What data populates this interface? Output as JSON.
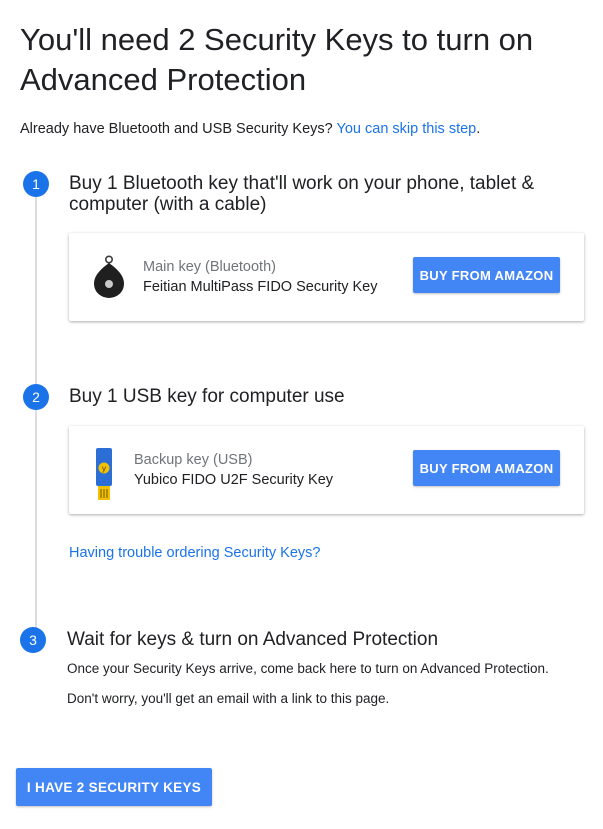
{
  "page": {
    "title": "You'll need 2 Security Keys to turn on Advanced Protection",
    "intro_text": "Already have Bluetooth and USB Security Keys? ",
    "intro_link": "You can skip this step",
    "intro_end": "."
  },
  "steps": [
    {
      "number": "1",
      "title": "Buy 1 Bluetooth key that'll work on your phone, tablet & computer (with a cable)",
      "card": {
        "icon": "bluetooth-key-icon",
        "key_type": "Main key (Bluetooth)",
        "key_name": "Feitian MultiPass FIDO Security Key",
        "button_label": "BUY FROM AMAZON"
      }
    },
    {
      "number": "2",
      "title": "Buy 1 USB key for computer use",
      "card": {
        "icon": "usb-key-icon",
        "key_type": "Backup key (USB)",
        "key_name": "Yubico FIDO U2F Security Key",
        "button_label": "BUY FROM AMAZON"
      },
      "help_link": "Having trouble ordering Security Keys?"
    },
    {
      "number": "3",
      "title": "Wait for keys & turn on Advanced Protection",
      "lines": [
        "Once your Security Keys arrive, come back here to turn on Advanced Protection.",
        "Don't worry, you'll get an email with a link to this page."
      ]
    }
  ],
  "primary_button": "I HAVE 2 SECURITY KEYS",
  "colors": {
    "accent": "#1a73e8",
    "button": "#4285f4"
  }
}
